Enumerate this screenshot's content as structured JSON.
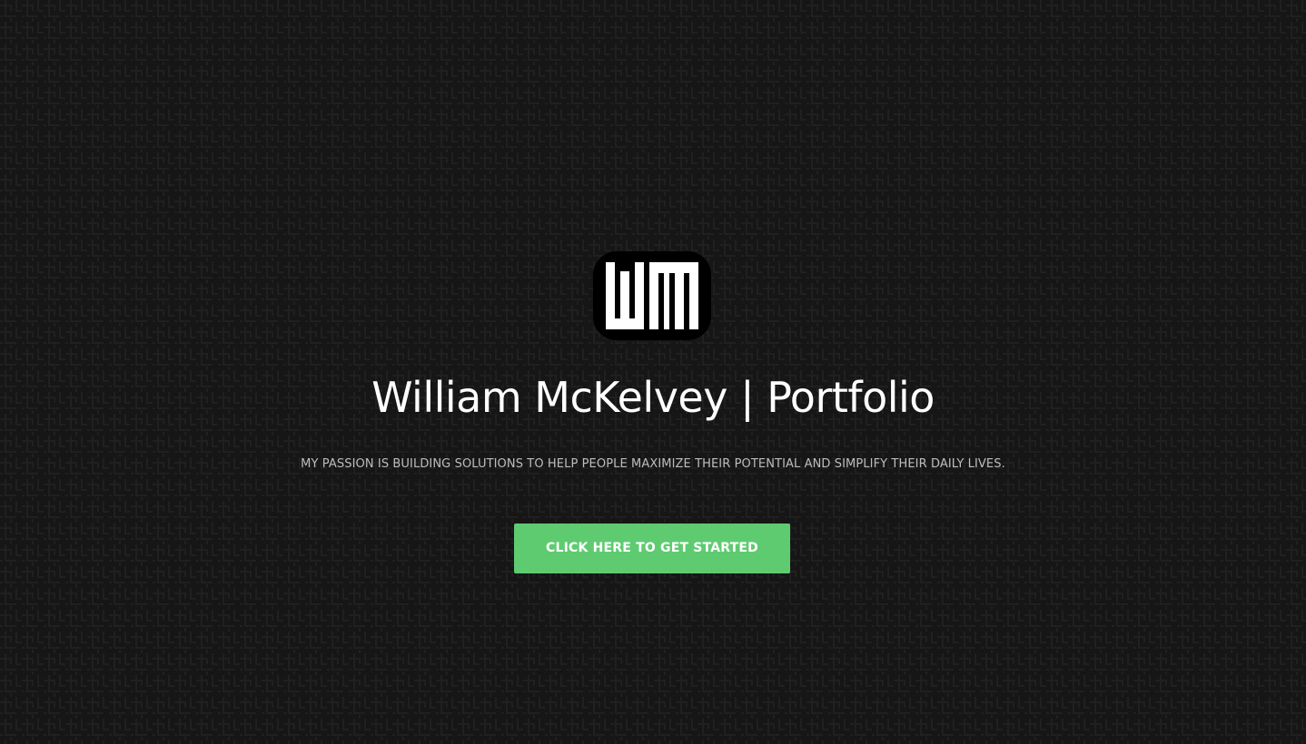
{
  "hero": {
    "logo_text": "WM",
    "title": "William McKelvey | Portfolio",
    "tagline": "MY PASSION IS BUILDING SOLUTIONS TO HELP PEOPLE MAXIMIZE THEIR POTENTIAL AND SIMPLIFY THEIR DAILY LIVES.",
    "cta_label": "CLICK HERE TO GET STARTED"
  },
  "colors": {
    "background": "#161616",
    "pattern": "#222222",
    "title": "#ffffff",
    "tagline": "#bdbdbd",
    "cta_background": "#5fcb71",
    "cta_text": "#ffffff"
  }
}
